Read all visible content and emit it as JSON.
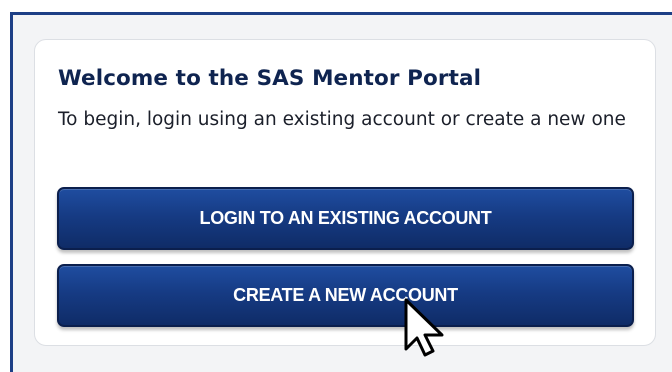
{
  "welcome": {
    "title": "Welcome to the SAS Mentor Portal",
    "subtitle": "To begin, login using an existing account or create a new one"
  },
  "actions": {
    "login_label": "LOGIN TO AN EXISTING ACCOUNT",
    "create_label": "CREATE A NEW ACCOUNT"
  },
  "colors": {
    "button_primary": "#163b84",
    "title_text": "#0f2450",
    "frame_border": "#1d3f86"
  },
  "icons": {
    "pointer": "mouse-pointer-icon"
  }
}
